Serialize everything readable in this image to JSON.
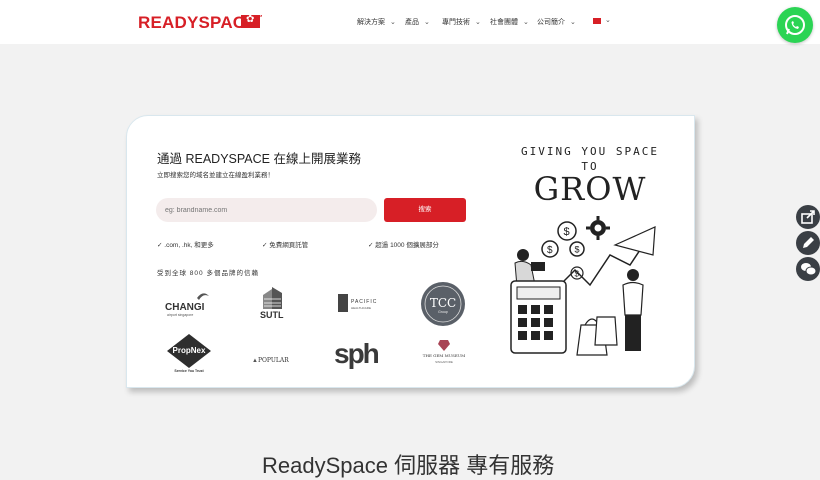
{
  "header": {
    "logo": "READYSPACE",
    "logo_tm": "™",
    "nav": [
      {
        "label": "解決方案"
      },
      {
        "label": "產品"
      },
      {
        "label": "專門技術"
      },
      {
        "label": "社會團體"
      },
      {
        "label": "公司簡介"
      }
    ]
  },
  "hero": {
    "headline": "通過 READYSPACE 在線上開展業務",
    "subline": "立即搜索您的域名並建立在線盈利業務！",
    "search_placeholder": "eg: brandname.com",
    "search_button": "搜索",
    "features": [
      ".com, .hk, 和更多",
      "免費網頁託管",
      "超過 1000 個擴展部分"
    ],
    "trusted_by": "受到全球 800 多個品牌的信賴",
    "brands": [
      {
        "name": "CHANGI",
        "sub": "airport singapore"
      },
      {
        "name": "SUTL"
      },
      {
        "name": "PACIFIC",
        "sub": "HEALTHCARE"
      },
      {
        "name": "TCC",
        "sub": "Group"
      },
      {
        "name": "PropNex",
        "sub": "Service You Trust"
      },
      {
        "name": "POPULAR"
      },
      {
        "name": "sph"
      },
      {
        "name": "THE GEM MUSEUM",
        "sub": "SINGAPORE"
      }
    ],
    "art": {
      "line1": "GIVING YOU SPACE",
      "line2": "TO",
      "line3": "GROW"
    }
  },
  "bottom": {
    "title": "ReadySpace 伺服器 專有服務"
  },
  "colors": {
    "brand_red": "#d71f26",
    "whatsapp_green": "#2bd454",
    "side_button": "#3a3f45"
  },
  "icons": [
    "whatsapp-icon",
    "share-icon",
    "pencil-icon",
    "chat-icon",
    "chevron-down-icon",
    "hk-flag-icon"
  ]
}
